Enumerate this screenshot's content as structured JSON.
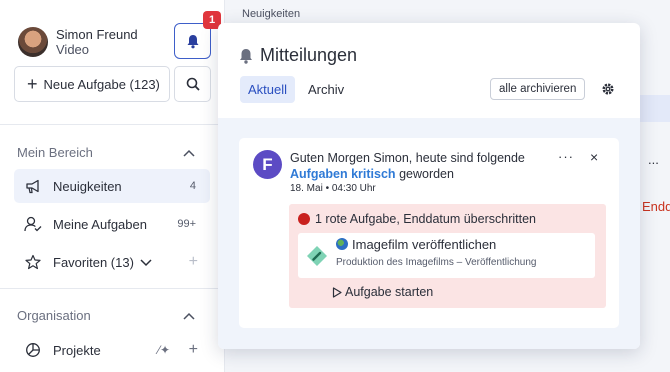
{
  "user": {
    "name": "Simon Freund",
    "role": "Video"
  },
  "notifications_badge": "1",
  "new_task_label": "Neue Aufgabe (123)",
  "sidebar": {
    "section_mein_bereich": "Mein Bereich",
    "items": [
      {
        "label": "Neuigkeiten",
        "count": "4",
        "icon": "megaphone-icon"
      },
      {
        "label": "Meine Aufgaben",
        "count": "99+",
        "icon": "user-check-icon"
      },
      {
        "label": "Favoriten (13)",
        "icon": "star-icon"
      }
    ],
    "section_organisation": "Organisation",
    "org_items": [
      {
        "label": "Projekte",
        "icon": "pie-chart-icon"
      }
    ]
  },
  "breadcrumb": "Neuigkeiten",
  "background": {
    "dots": "...",
    "red_text": "Enddatu"
  },
  "popup": {
    "title": "Mitteilungen",
    "tabs": [
      "Aktuell",
      "Archiv"
    ],
    "active_tab": "Aktuell",
    "archive_all_label": "alle archivieren",
    "notification": {
      "avatar_letter": "F",
      "message_before": "Guten Morgen Simon, heute sind folgende",
      "message_highlight": "Aufgaben kritisch",
      "message_after": "geworden",
      "date": "18. Mai • 04:30 Uhr",
      "dots": "···",
      "close": "×",
      "alert_heading": "1 rote Aufgabe, Enddatum überschritten",
      "task_title": "Imagefilm veröffentlichen",
      "task_subtitle": "Produktion des Imagefilms – Veröffentlichung",
      "start_label": "Aufgabe starten"
    }
  },
  "colors": {
    "accent": "#2a4fc0",
    "badge": "#e0363d",
    "alert_bg": "#fbe4e4",
    "avatar": "#5c4bc4",
    "highlight": "#2f7ad6"
  }
}
